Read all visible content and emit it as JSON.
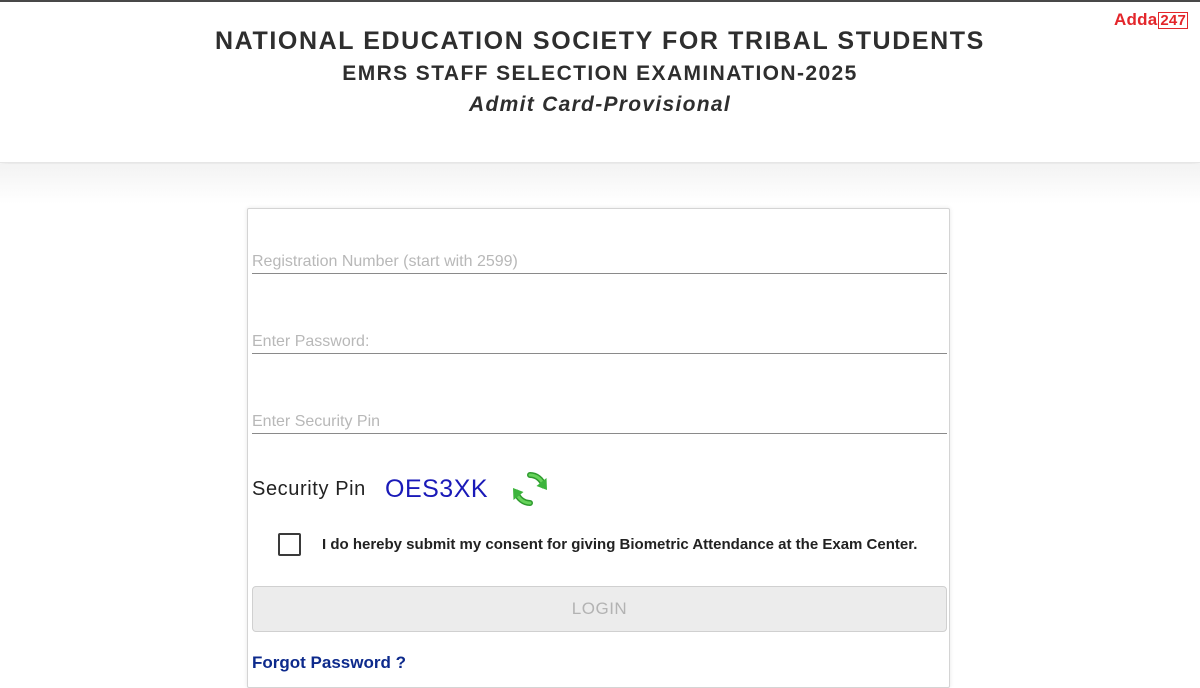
{
  "header": {
    "org_title": "NATIONAL EDUCATION SOCIETY FOR TRIBAL STUDENTS",
    "exam_title": "EMRS STAFF SELECTION EXAMINATION-2025",
    "card_title": "Admit Card-Provisional",
    "brand": {
      "text": "Adda",
      "number": "247",
      "color": "#e3262b"
    }
  },
  "form": {
    "registration": {
      "placeholder": "Registration Number (start with 2599)",
      "value": ""
    },
    "password": {
      "placeholder": "Enter Password:",
      "value": ""
    },
    "security_pin": {
      "placeholder": "Enter Security Pin",
      "value": ""
    },
    "captcha": {
      "label": "Security Pin",
      "code": "OES3XK",
      "code_color": "#1a1ab8",
      "refresh_icon": "refresh-icon",
      "refresh_color": "#3cb43c"
    },
    "consent": {
      "text": "I do hereby submit my consent for giving Biometric Attendance at the Exam Center.",
      "checked": false
    },
    "login_button": {
      "label": "LOGIN",
      "state": "disabled"
    },
    "forgot_password": {
      "label": "Forgot Password ?",
      "color": "#0d2a8c"
    }
  }
}
